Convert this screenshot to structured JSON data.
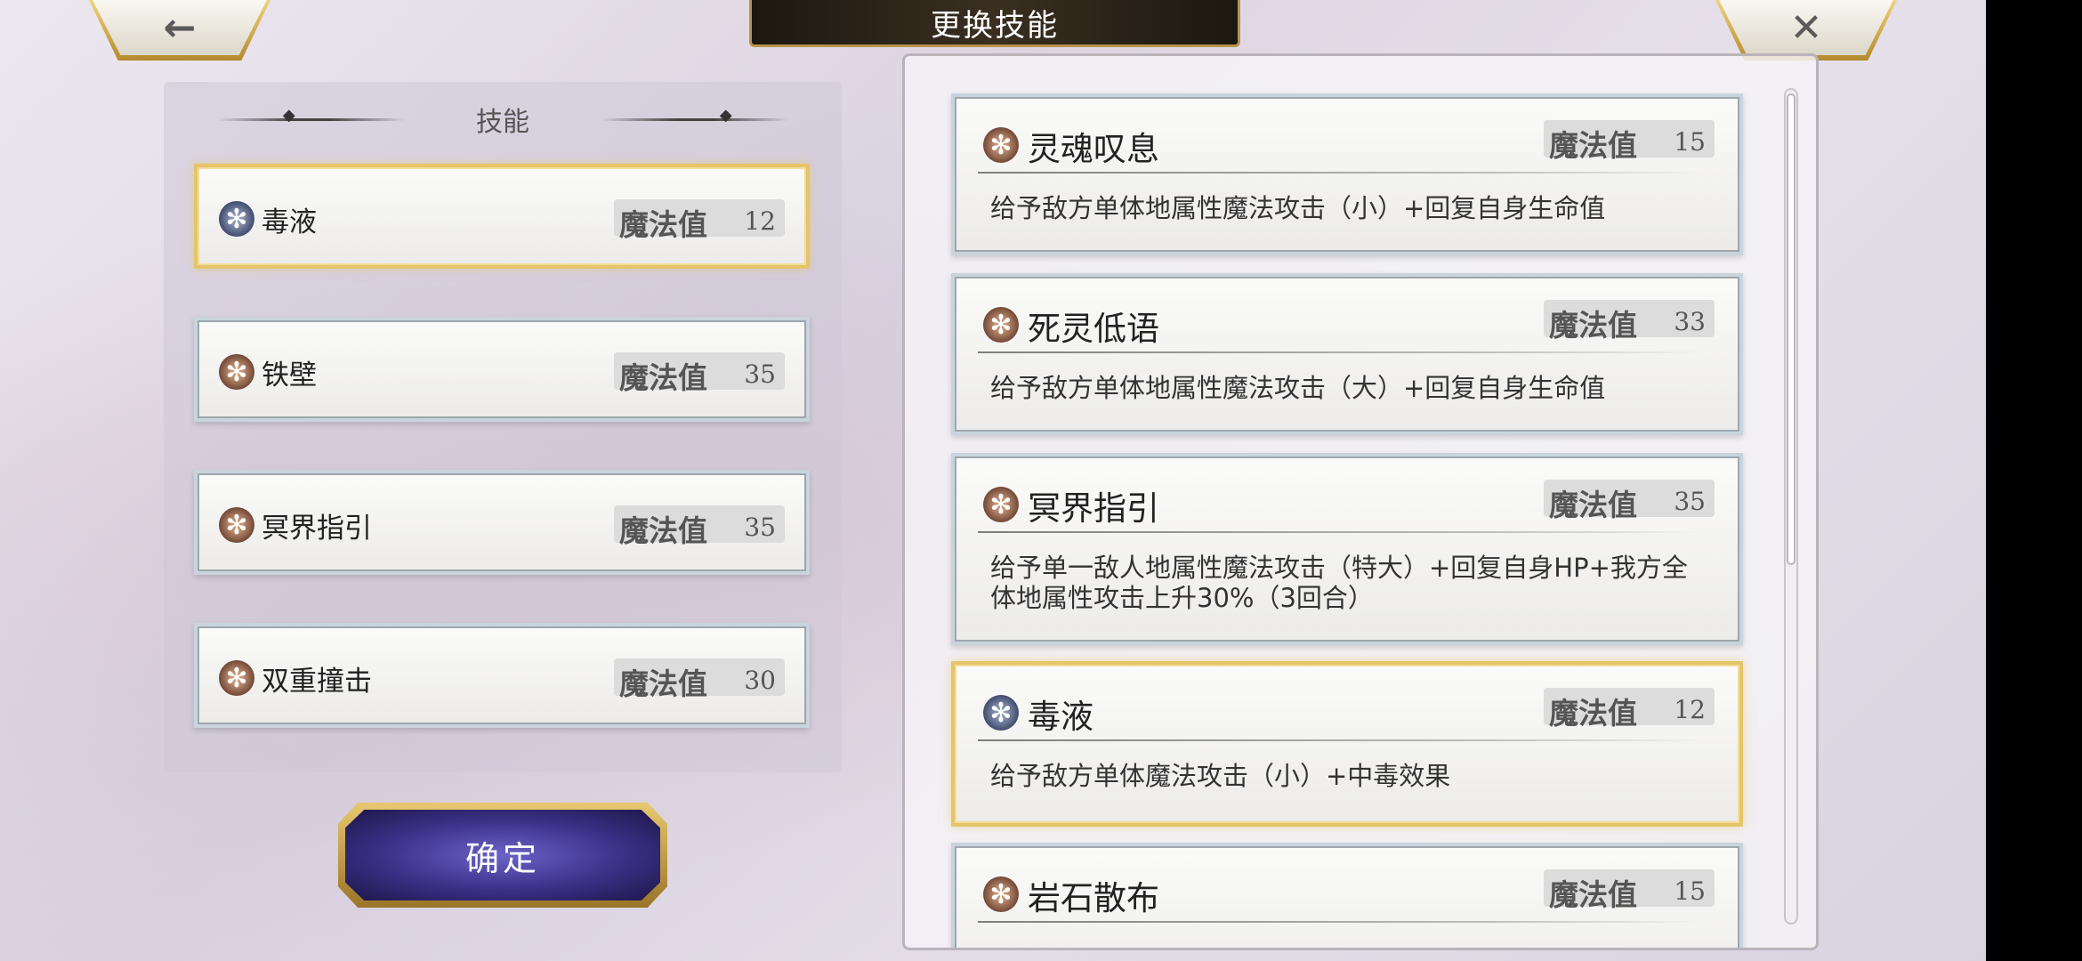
{
  "header": {
    "title": "更换技能",
    "back_glyph": "←",
    "close_glyph": "✕"
  },
  "left_panel": {
    "heading": "技能",
    "slots": [
      {
        "name": "毒液",
        "mp_label": "魔法值",
        "mp": "12",
        "icon": "skill-orb-blue",
        "selected": true
      },
      {
        "name": "铁壁",
        "mp_label": "魔法值",
        "mp": "35",
        "icon": "skill-orb-brown",
        "selected": false
      },
      {
        "name": "冥界指引",
        "mp_label": "魔法值",
        "mp": "35",
        "icon": "skill-orb-brown",
        "selected": false
      },
      {
        "name": "双重撞击",
        "mp_label": "魔法值",
        "mp": "30",
        "icon": "skill-orb-brown",
        "selected": false
      }
    ],
    "confirm_label": "确定"
  },
  "skill_list": [
    {
      "name": "灵魂叹息",
      "mp_label": "魔法值",
      "mp": "15",
      "desc": "给予敌方单体地属性魔法攻击（小）+回复自身生命值",
      "icon": "skill-orb-brown",
      "selected": false
    },
    {
      "name": "死灵低语",
      "mp_label": "魔法值",
      "mp": "33",
      "desc": "给予敌方单体地属性魔法攻击（大）+回复自身生命值",
      "icon": "skill-orb-brown",
      "selected": false
    },
    {
      "name": "冥界指引",
      "mp_label": "魔法值",
      "mp": "35",
      "desc": "给予单一敌人地属性魔法攻击（特大）+回复自身HP+我方全体地属性攻击上升30%（3回合）",
      "icon": "skill-orb-brown",
      "selected": false
    },
    {
      "name": "毒液",
      "mp_label": "魔法值",
      "mp": "12",
      "desc": "给予敌方单体魔法攻击（小）+中毒效果",
      "icon": "skill-orb-blue",
      "selected": true
    },
    {
      "name": "岩石散布",
      "mp_label": "魔法值",
      "mp": "15",
      "desc": "",
      "icon": "skill-orb-brown",
      "selected": false
    }
  ],
  "colors": {
    "selected_border": "#e5c56a",
    "confirm_bg": "#3b2f86",
    "title_bg": "#2a2218"
  }
}
